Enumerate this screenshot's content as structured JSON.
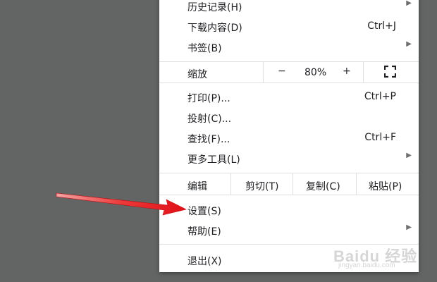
{
  "menu": {
    "history": {
      "label": "历史记录(H)",
      "arrow": "▶"
    },
    "downloads": {
      "label": "下载内容(D)",
      "shortcut": "Ctrl+J"
    },
    "bookmarks": {
      "label": "书签(B)",
      "arrow": "▶"
    },
    "zoom": {
      "label": "缩放",
      "minus": "−",
      "value": "80%",
      "plus": "+"
    },
    "print": {
      "label": "打印(P)...",
      "shortcut": "Ctrl+P"
    },
    "cast": {
      "label": "投射(C)..."
    },
    "find": {
      "label": "查找(F)...",
      "shortcut": "Ctrl+F"
    },
    "more_tools": {
      "label": "更多工具(L)",
      "arrow": "▶"
    },
    "edit": {
      "label": "编辑",
      "cut": "剪切(T)",
      "copy": "复制(C)",
      "paste": "粘贴(P)"
    },
    "settings": {
      "label": "设置(S)"
    },
    "help": {
      "label": "帮助(E)",
      "arrow": "▶"
    },
    "exit": {
      "label": "退出(X)"
    }
  },
  "icons": {
    "fullscreen": "fullscreen-icon",
    "submenu": "chevron-right-icon"
  },
  "annotation": {
    "arrow_color": "#e8141b"
  },
  "watermark": {
    "text": "Baidu 经验",
    "url": "jingyan.baidu.com"
  }
}
